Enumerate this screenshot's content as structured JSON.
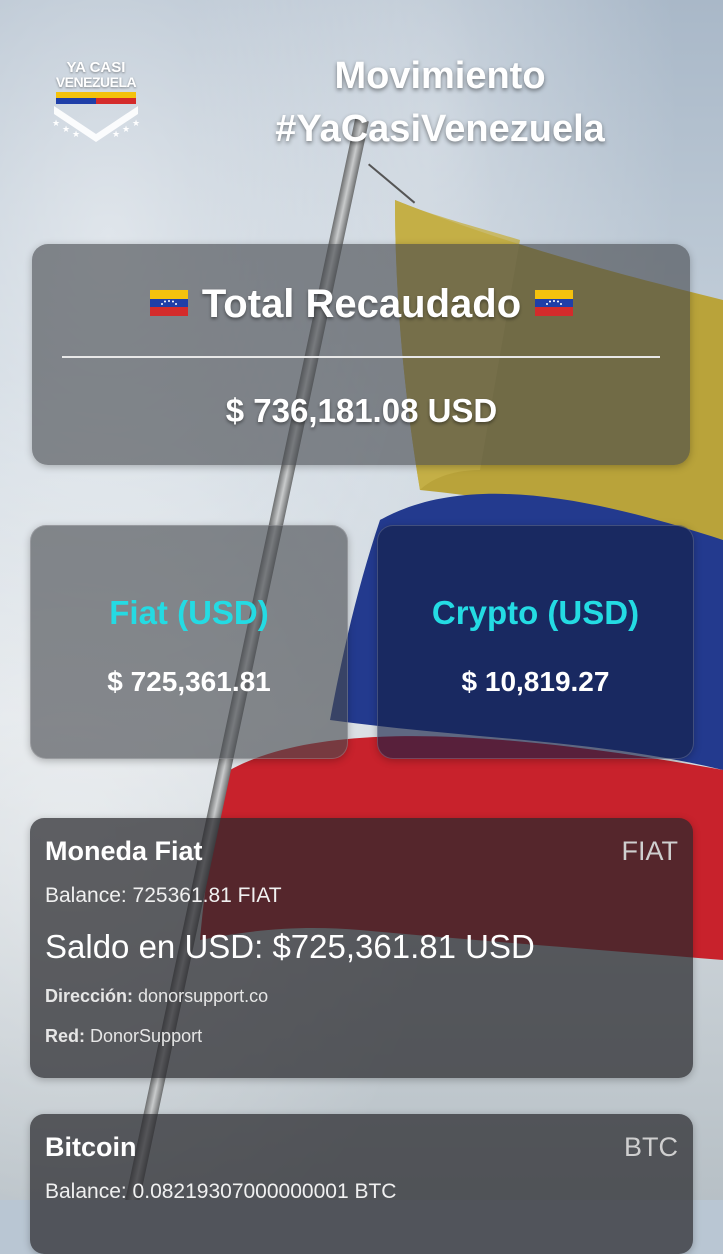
{
  "header": {
    "logo_line1": "YA CASI",
    "logo_line2": "VENEZUELA",
    "title_line1": "Movimiento",
    "title_line2": "#YaCasiVenezuela"
  },
  "total": {
    "title": "Total Recaudado",
    "amount": "$ 736,181.08 USD"
  },
  "fiat_box": {
    "label": "Fiat (USD)",
    "value": "$ 725,361.81"
  },
  "crypto_box": {
    "label": "Crypto (USD)",
    "value": "$ 10,819.27"
  },
  "accounts": [
    {
      "name": "Moneda Fiat",
      "code": "FIAT",
      "balance": "Balance: 725361.81 FIAT",
      "usd": "Saldo en USD: $725,361.81 USD",
      "address_label": "Dirección:",
      "address": "donorsupport.co",
      "network_label": "Red:",
      "network": "DonorSupport"
    },
    {
      "name": "Bitcoin",
      "code": "BTC",
      "balance": "Balance: 0.08219307000000001 BTC"
    }
  ],
  "colors": {
    "accent_cyan": "#24dbe3",
    "flag_yellow": "#f4c20d",
    "flag_blue": "#1f3fa8",
    "flag_red": "#d42b2b"
  }
}
